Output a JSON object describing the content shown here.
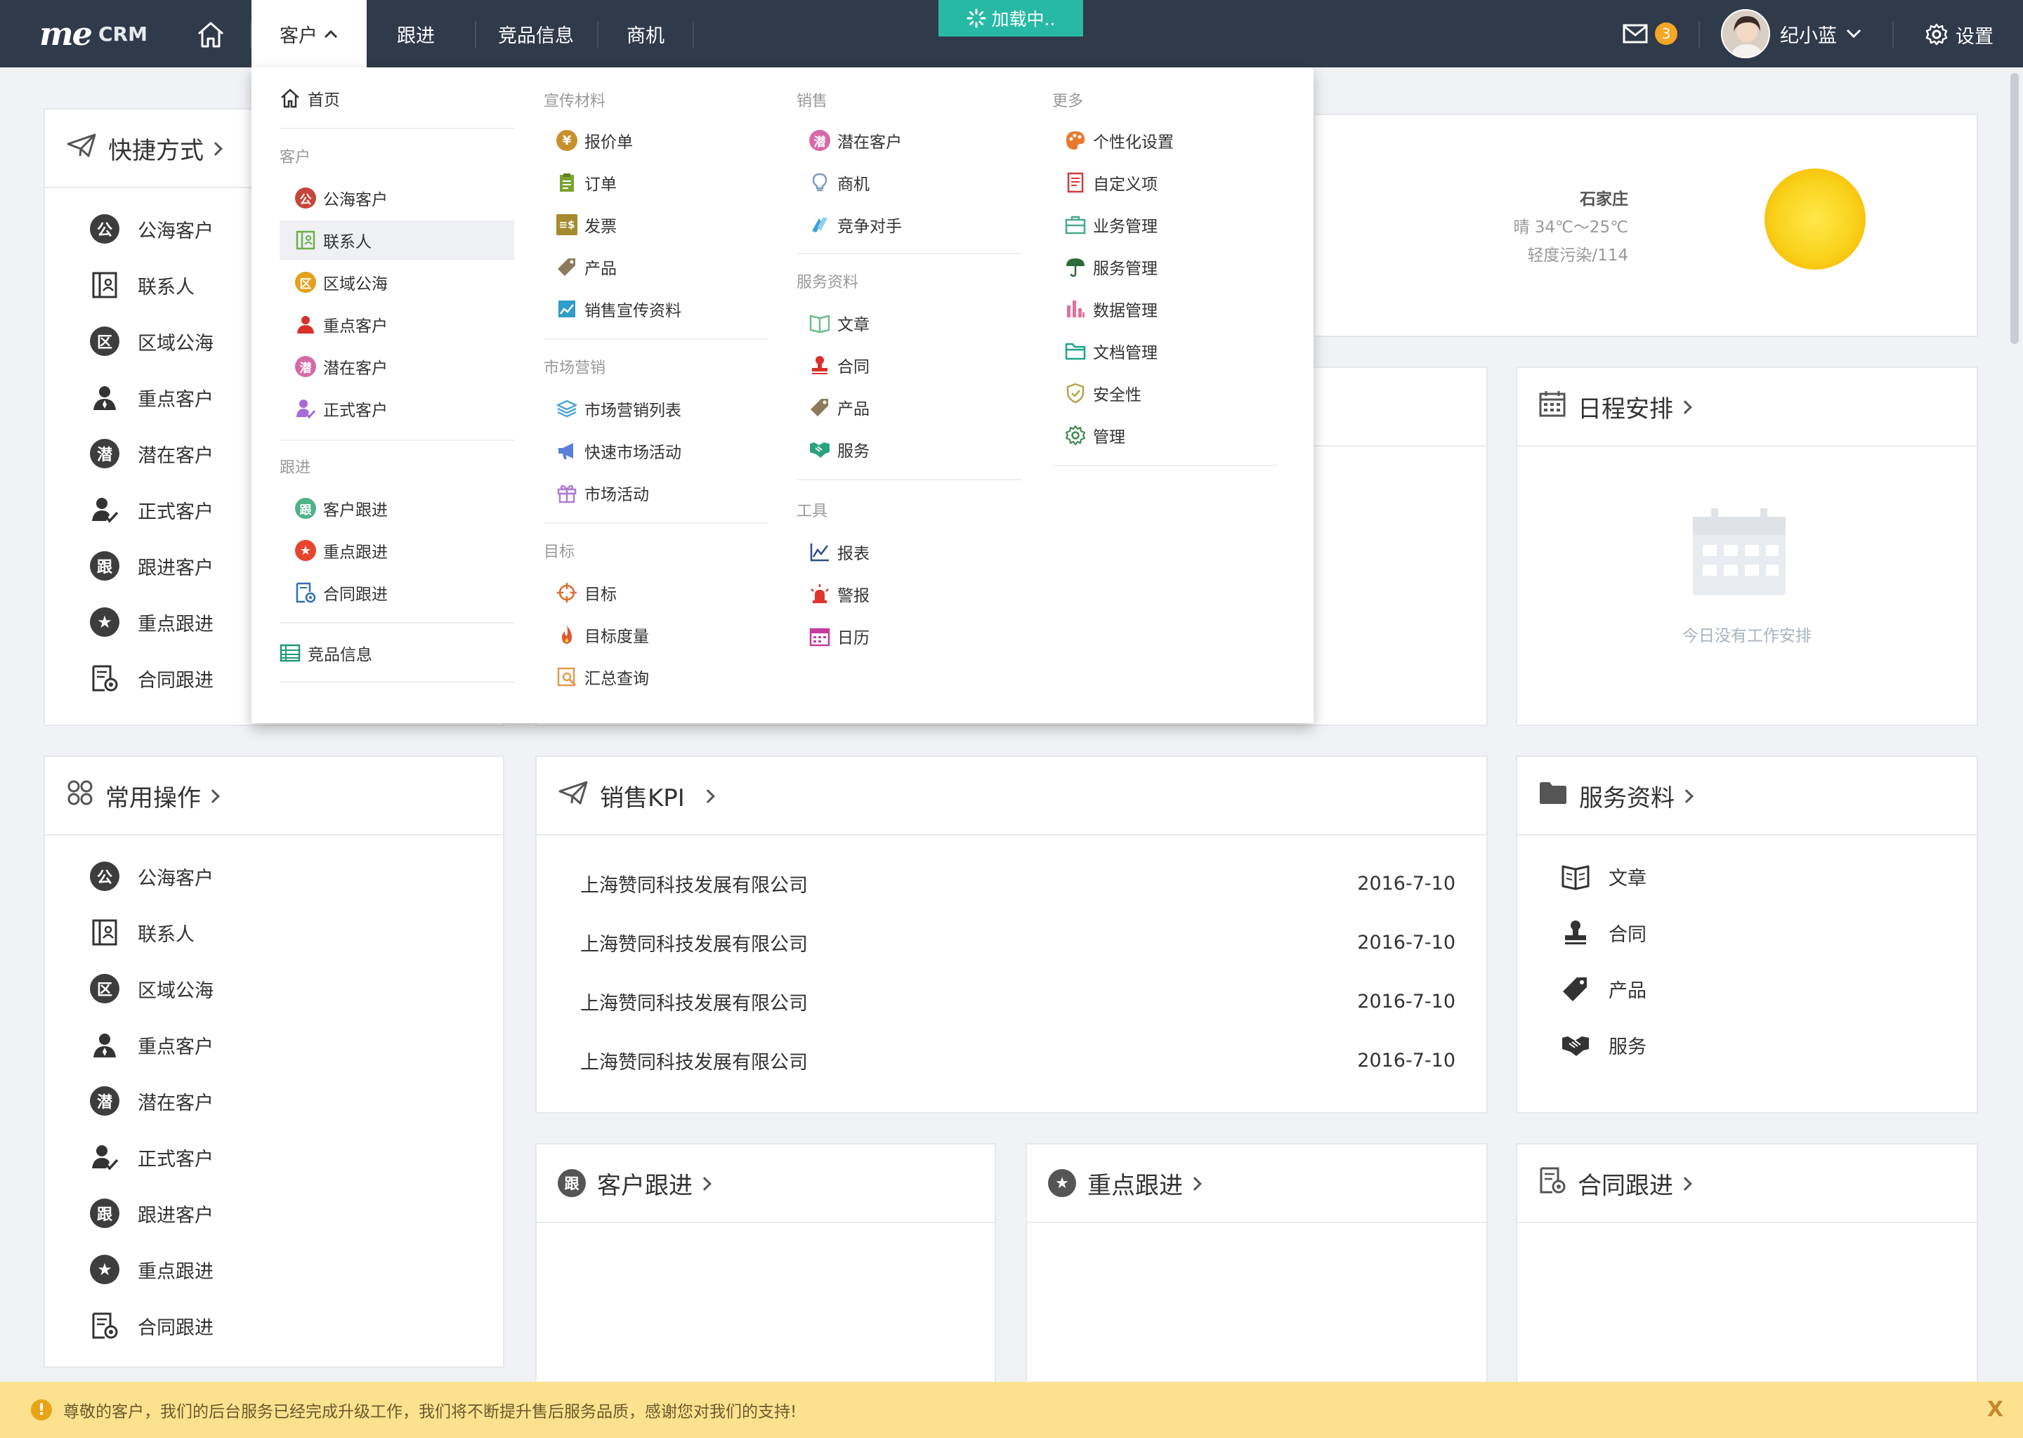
{
  "app": {
    "logo_me": "me",
    "logo_crm": "CRM"
  },
  "nav": {
    "items": [
      {
        "label": "客户"
      },
      {
        "label": "跟进"
      },
      {
        "label": "竞品信息"
      },
      {
        "label": "商机"
      }
    ],
    "loading": "加载中.."
  },
  "header": {
    "mail_count": "3",
    "user_name": "纪小蓝",
    "settings": "设置"
  },
  "dropdown": {
    "home": "首页",
    "customer_head": "客户",
    "customer_items": [
      "公海客户",
      "联系人",
      "区域公海",
      "重点客户",
      "潜在客户",
      "正式客户"
    ],
    "followup_head": "跟进",
    "followup_items": [
      "客户跟进",
      "重点跟进",
      "合同跟进"
    ],
    "competitor": "竞品信息",
    "promo_head": "宣传材料",
    "promo_items": [
      "报价单",
      "订单",
      "发票",
      "产品",
      "销售宣传资料"
    ],
    "market_head": "市场营销",
    "market_items": [
      "市场营销列表",
      "快速市场活动",
      "市场活动"
    ],
    "target_head": "目标",
    "target_items": [
      "目标",
      "目标度量",
      "汇总查询"
    ],
    "sales_head": "销售",
    "sales_items": [
      "潜在客户",
      "商机",
      "竞争对手"
    ],
    "service_head": "服务资料",
    "service_items": [
      "文章",
      "合同",
      "产品",
      "服务"
    ],
    "tools_head": "工具",
    "tools_items": [
      "报表",
      "警报",
      "日历"
    ],
    "more_head": "更多",
    "more_items": [
      "个性化设置",
      "自定义项",
      "业务管理",
      "服务管理",
      "数据管理",
      "文档管理",
      "安全性",
      "管理"
    ]
  },
  "quick": {
    "title": "快捷方式",
    "items": [
      "公海客户",
      "联系人",
      "区域公海",
      "重点客户",
      "潜在客户",
      "正式客户",
      "跟进客户",
      "重点跟进",
      "合同跟进"
    ]
  },
  "weather": {
    "city": "石家庄",
    "temp": "晴 34℃～25℃",
    "air": "轻度污染/114"
  },
  "schedule": {
    "title": "日程安排",
    "empty": "今日没有工作安排"
  },
  "common": {
    "title": "常用操作",
    "items": [
      "公海客户",
      "联系人",
      "区域公海",
      "重点客户",
      "潜在客户",
      "正式客户",
      "跟进客户",
      "重点跟进",
      "合同跟进"
    ]
  },
  "kpi": {
    "title": "销售KPI",
    "rows": [
      {
        "company": "上海赞同科技发展有限公司",
        "date": "2016-7-10"
      },
      {
        "company": "上海赞同科技发展有限公司",
        "date": "2016-7-10"
      },
      {
        "company": "上海赞同科技发展有限公司",
        "date": "2016-7-10"
      },
      {
        "company": "上海赞同科技发展有限公司",
        "date": "2016-7-10"
      }
    ]
  },
  "service": {
    "title": "服务资料",
    "items": [
      "文章",
      "合同",
      "产品",
      "服务"
    ]
  },
  "followup_cards": {
    "customer": "客户跟进",
    "key": "重点跟进",
    "contract": "合同跟进"
  },
  "notice": {
    "text": "尊敬的客户，我们的后台服务已经完成升级工作，我们将不断提升售后服务品质，感谢您对我们的支持!",
    "close": "X"
  },
  "colors": {
    "topbar": "#2f3a4b",
    "accent": "#27b9a4",
    "badge": "#f5a623",
    "notice_bg": "#fce28f"
  }
}
